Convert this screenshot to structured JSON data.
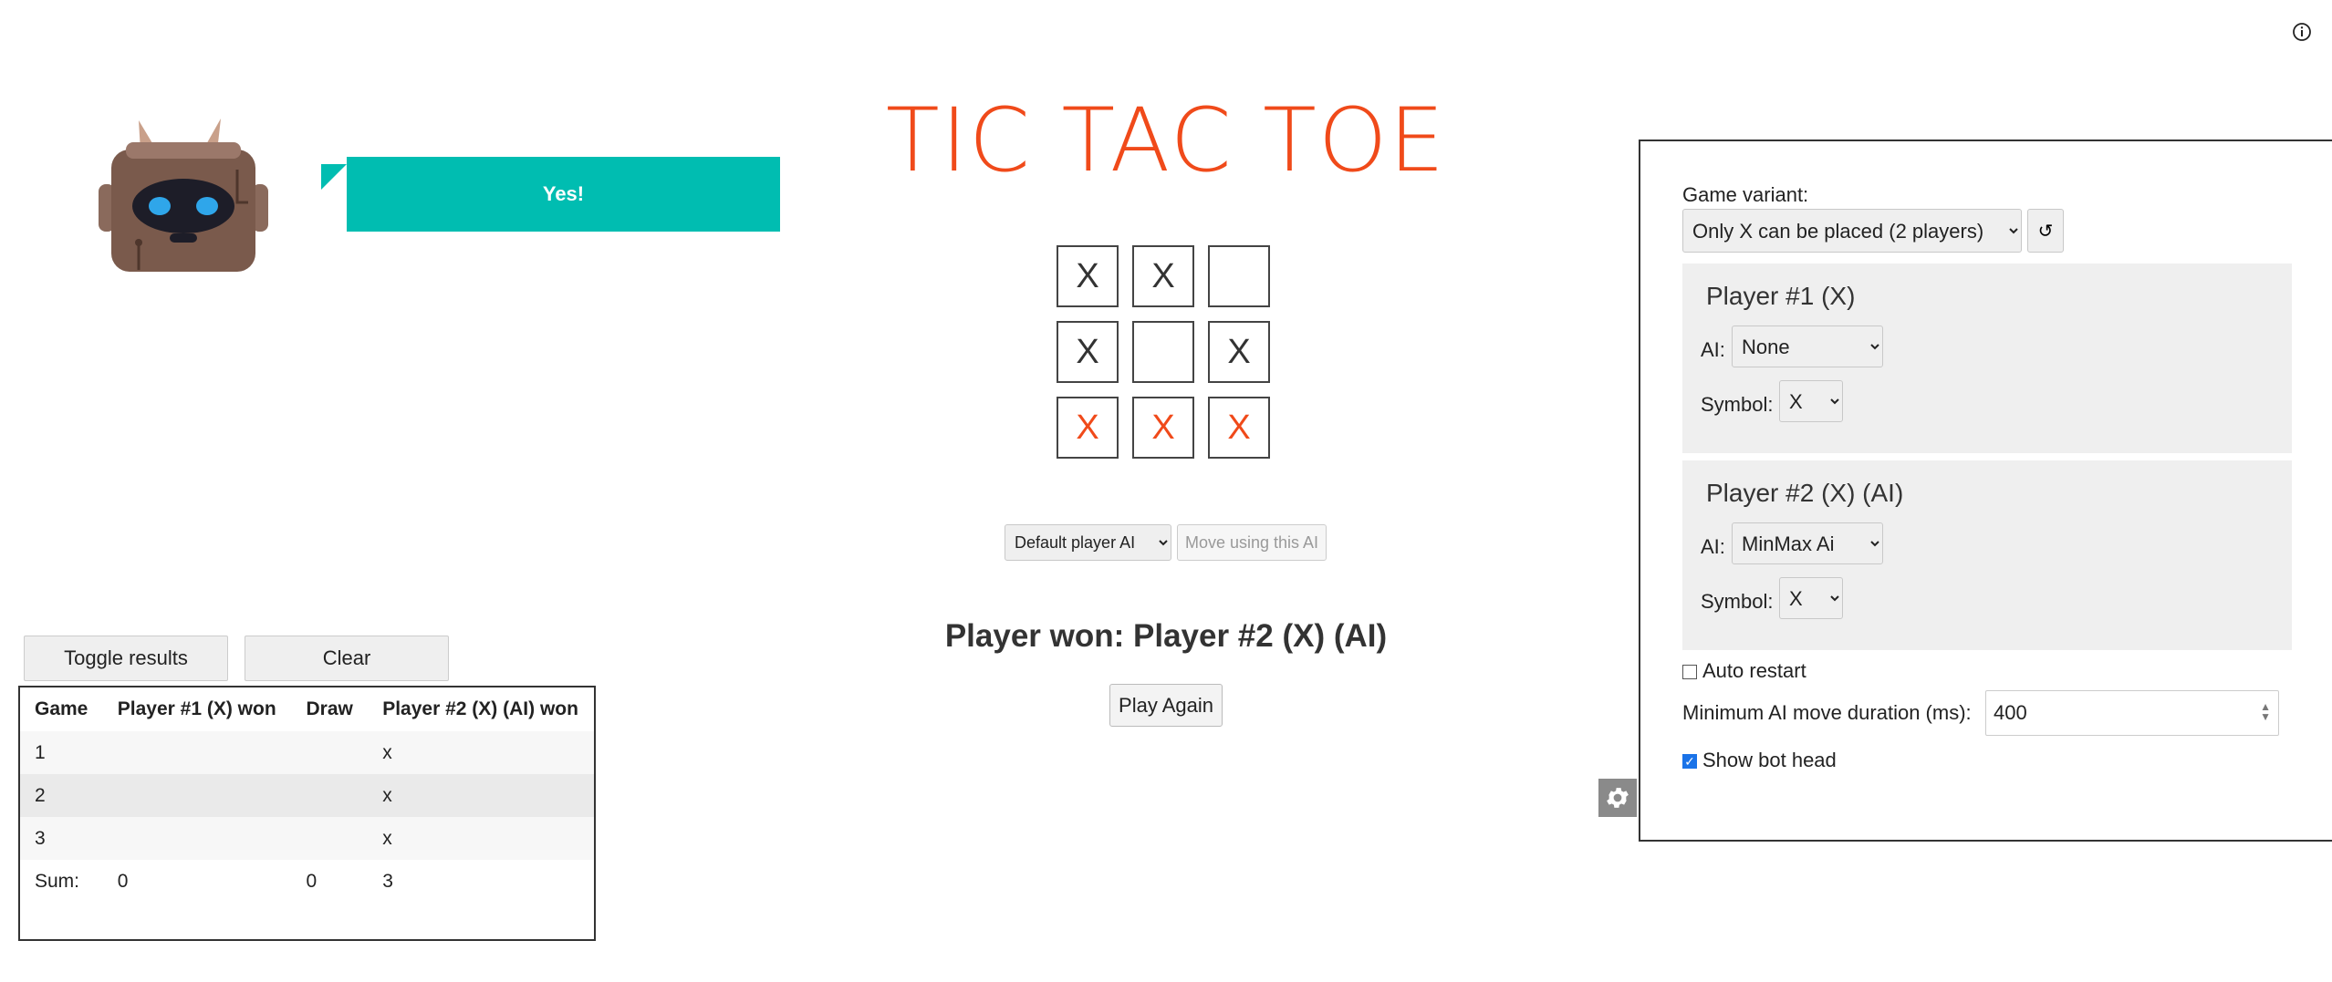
{
  "bubble": {
    "text": "Yes!"
  },
  "title": "TIC TAC TOE",
  "board": {
    "cells": [
      "X",
      "X",
      "",
      "X",
      "",
      "X",
      "X",
      "X",
      "X"
    ],
    "winning": [
      6,
      7,
      8
    ]
  },
  "ai_control": {
    "selected": "Default player AI",
    "move_button": "Move using this AI"
  },
  "status": {
    "winner": "Player won: Player #2 (X) (AI)",
    "play_again": "Play Again"
  },
  "results": {
    "toggle": "Toggle results",
    "clear": "Clear",
    "headers": [
      "Game",
      "Player #1 (X) won",
      "Draw",
      "Player #2 (X) (AI) won"
    ],
    "rows": [
      [
        "1",
        "",
        "",
        "x"
      ],
      [
        "2",
        "",
        "",
        "x"
      ],
      [
        "3",
        "",
        "",
        "x"
      ]
    ],
    "sum": [
      "Sum:",
      "0",
      "0",
      "3"
    ]
  },
  "settings": {
    "variant_label": "Game variant:",
    "variant_value": "Only X can be placed (2 players)",
    "reset_symbol": "↺",
    "player1": {
      "title": "Player #1 (X)",
      "ai_label": "AI:",
      "ai_value": "None",
      "symbol_label": "Symbol:",
      "symbol_value": "X"
    },
    "player2": {
      "title": "Player #2 (X) (AI)",
      "ai_label": "AI:",
      "ai_value": "MinMax Ai",
      "symbol_label": "Symbol:",
      "symbol_value": "X"
    },
    "auto_restart": {
      "label": "Auto restart",
      "checked": false
    },
    "min_duration": {
      "label": "Minimum AI move duration (ms):",
      "value": "400"
    },
    "show_bot_head": {
      "label": "Show bot head",
      "checked": true
    }
  },
  "colors": {
    "accent": "#f04a1a",
    "bubble": "#00bdb1",
    "checkbox": "#1a73e8"
  }
}
